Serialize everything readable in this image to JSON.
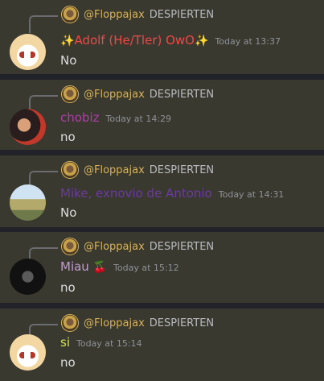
{
  "reply": {
    "name": "@Floppajax",
    "text": "DESPIERTEN"
  },
  "messages": [
    {
      "name": "Adolf (He/Tler) OwO",
      "name_color": "#f04747",
      "prefix_icon": "sparkles",
      "suffix_icon": "sparkles",
      "timestamp": "Today at 13:37",
      "content": "No",
      "avatar": "anime-blonde-avatar"
    },
    {
      "name": "chobiz",
      "name_color": "#b03ca8",
      "timestamp": "Today at 14:29",
      "content": "no",
      "avatar": "dark-hair-avatar"
    },
    {
      "name": "Mike, exnovio de Antonio",
      "name_color": "#6b3aa0",
      "timestamp": "Today at 14:31",
      "content": "No",
      "avatar": "landscape-avatar"
    },
    {
      "name": "Miau",
      "name_color": "#c39bd3",
      "suffix_icon": "cherries",
      "timestamp": "Today at 15:12",
      "content": "no",
      "avatar": "dark-figure-avatar"
    },
    {
      "name": "si",
      "name_color": "#d4e157",
      "timestamp": "Today at 15:14",
      "content": "no",
      "avatar": "anime-blonde-avatar"
    }
  ]
}
